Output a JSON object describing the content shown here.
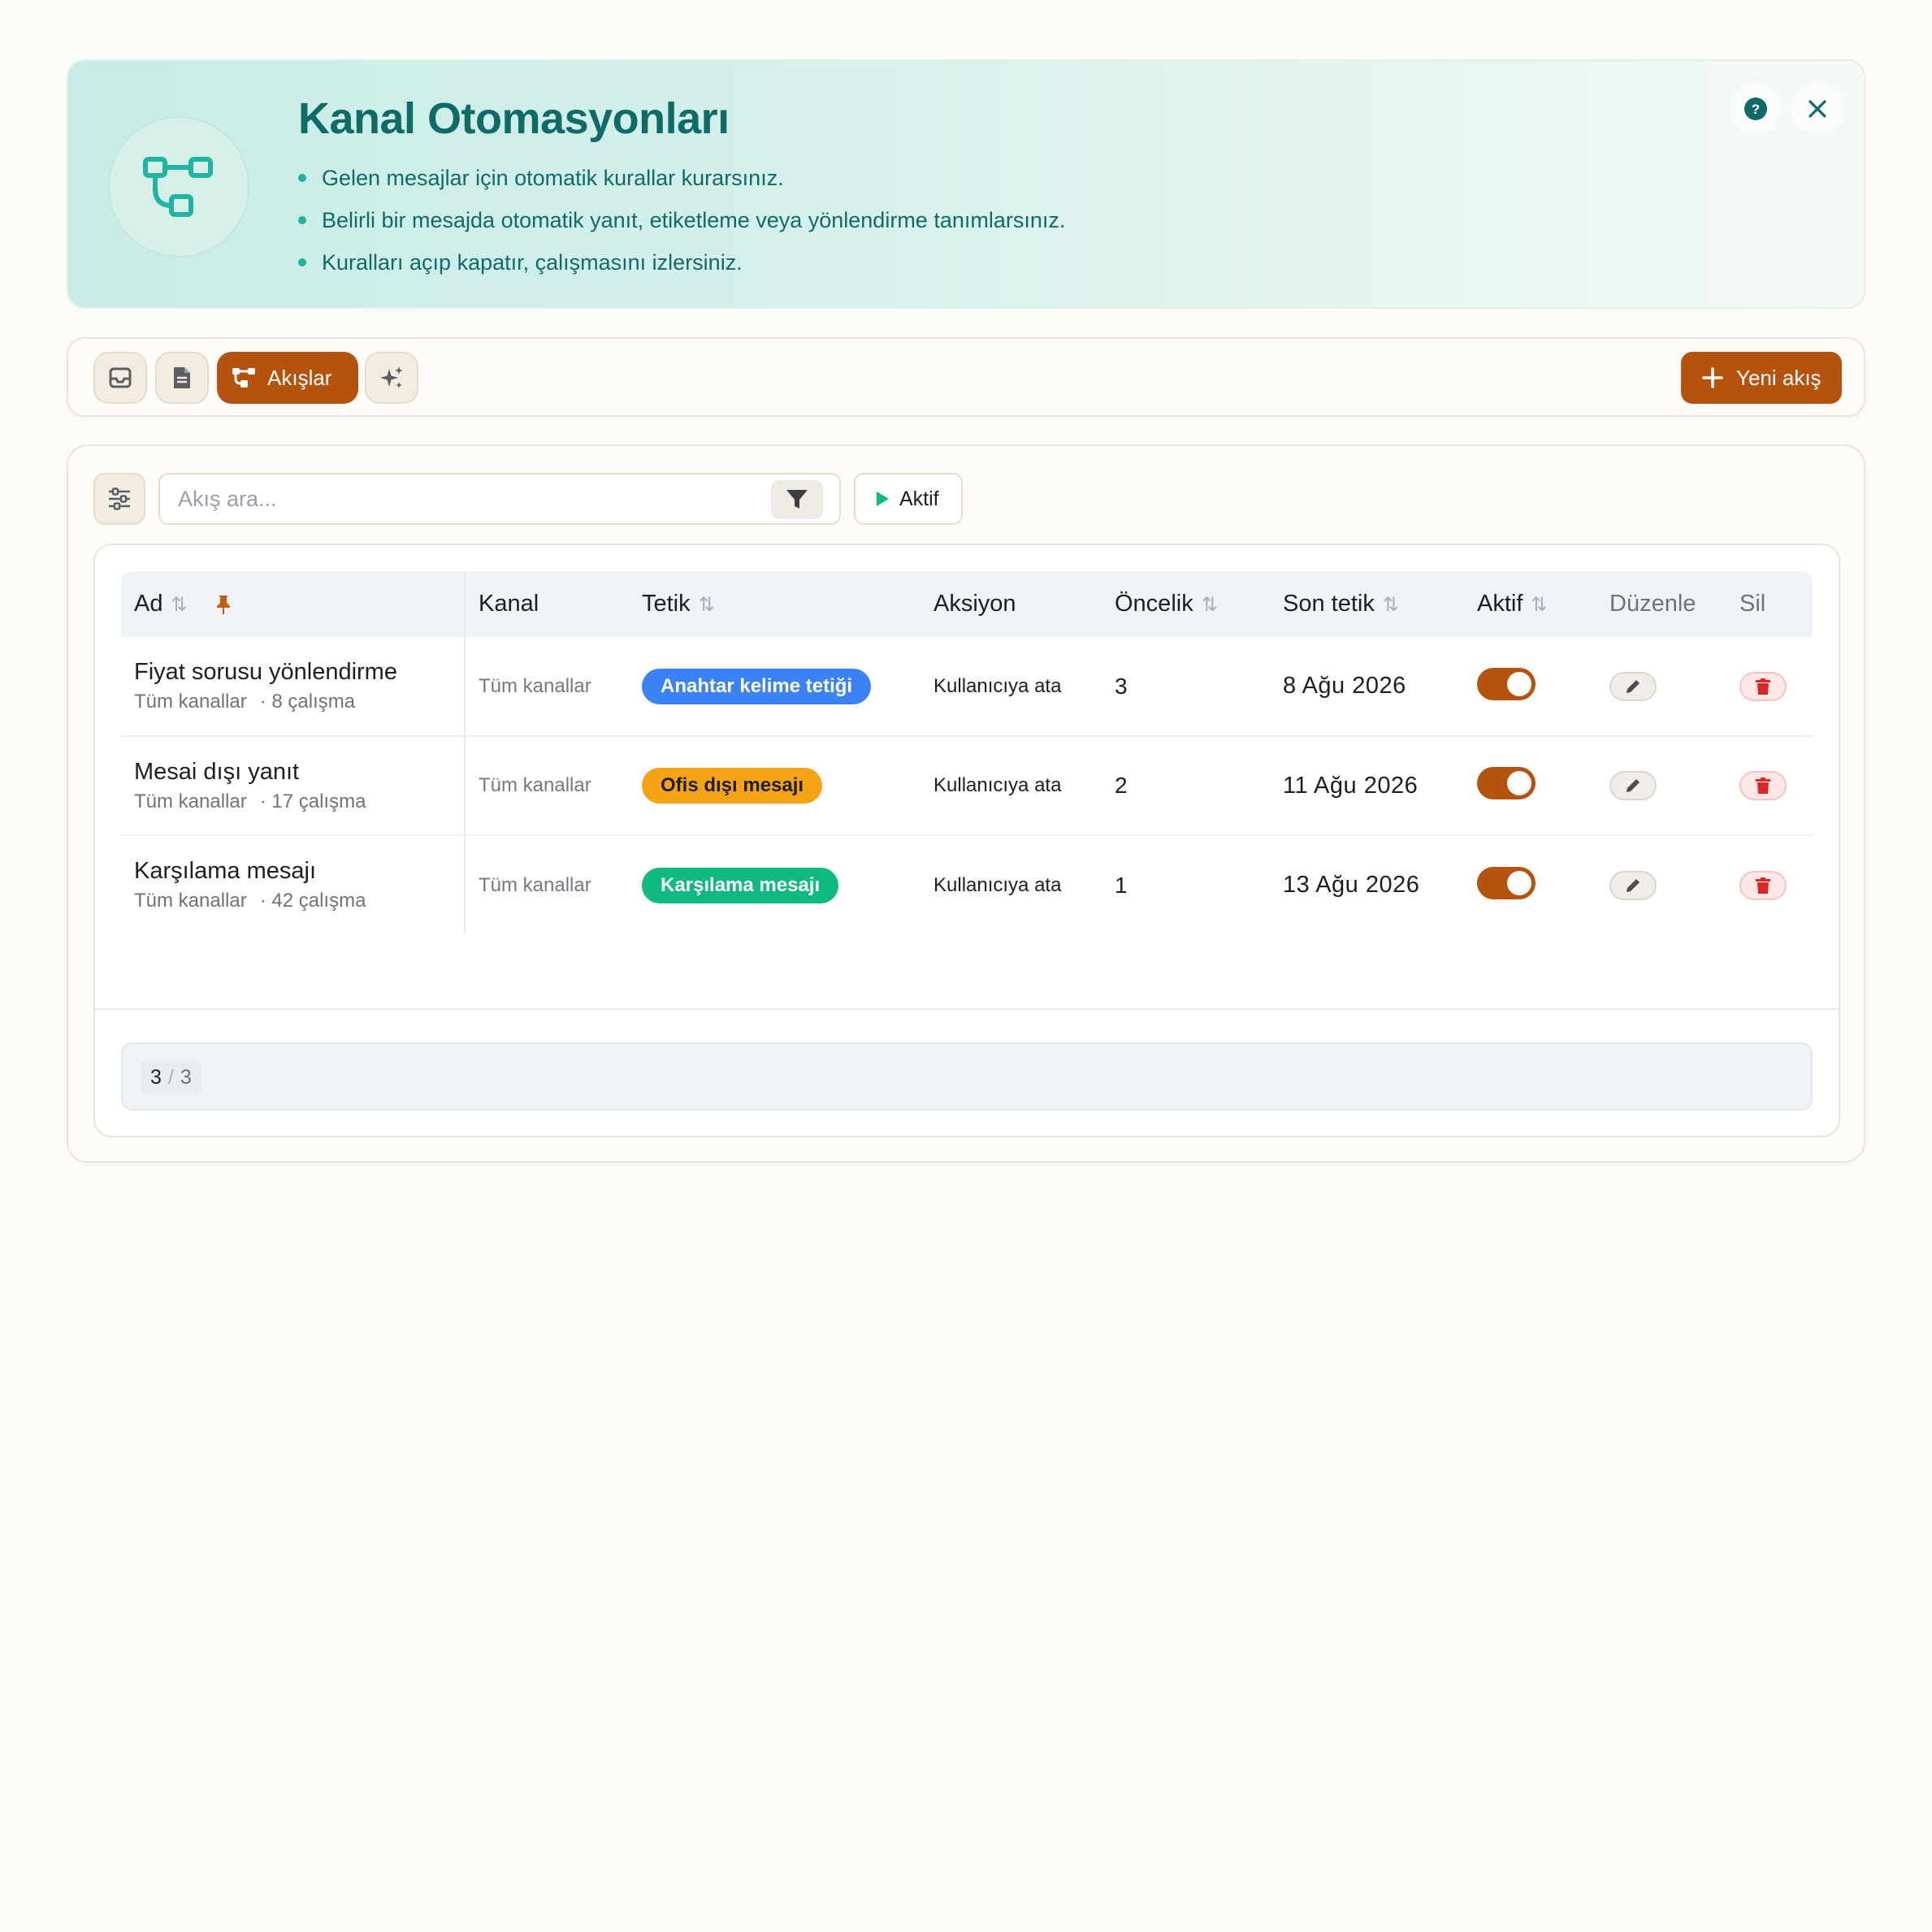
{
  "hero": {
    "title": "Kanal Otomasyonları",
    "bullets": [
      "Gelen mesajlar için otomatik kurallar kurarsınız.",
      "Belirli bir mesajda otomatik yanıt, etiketleme veya yönlendirme tanımlarsınız.",
      "Kuralları açıp kapatır, çalışmasını izlersiniz."
    ],
    "icon": "flow-diagram-icon",
    "actions": [
      "help-icon",
      "close-icon"
    ]
  },
  "toolbar": {
    "tabs": [
      {
        "icon": "inbox-icon"
      },
      {
        "icon": "document-icon"
      },
      {
        "icon": "flow-icon",
        "label": "Akışlar",
        "active": true
      },
      {
        "icon": "sparkle-icon"
      }
    ],
    "new_button": "Yeni akış"
  },
  "filters": {
    "search_placeholder": "Akış ara...",
    "search_value": "",
    "status_chip": "Aktif"
  },
  "table": {
    "columns": {
      "name": "Ad",
      "channel": "Kanal",
      "trigger": "Tetik",
      "action": "Aksiyon",
      "priority": "Öncelik",
      "last_trigger": "Son tetik",
      "active": "Aktif",
      "edit": "Düzenle",
      "delete": "Sil"
    },
    "rows": [
      {
        "name": "Fiyat sorusu yönlendirme",
        "sub_channel": "Tüm kanallar",
        "runs": "· 8 çalışma",
        "channel": "Tüm kanallar",
        "trigger": "Anahtar kelime tetiği",
        "trigger_color": "#3b82f6",
        "action": "Kullanıcıya ata",
        "priority": "3",
        "last_trigger": "8 Ağu 2026",
        "active": true
      },
      {
        "name": "Mesai dışı yanıt",
        "sub_channel": "Tüm kanallar",
        "runs": "· 17 çalışma",
        "channel": "Tüm kanallar",
        "trigger": "Ofis dışı mesajı",
        "trigger_color": "#f5a314",
        "action": "Kullanıcıya ata",
        "priority": "2",
        "last_trigger": "11 Ağu 2026",
        "active": true
      },
      {
        "name": "Karşılama mesajı",
        "sub_channel": "Tüm kanallar",
        "runs": "· 42 çalışma",
        "channel": "Tüm kanallar",
        "trigger": "Karşılama mesajı",
        "trigger_color": "#10b981",
        "action": "Kullanıcıya ata",
        "priority": "1",
        "last_trigger": "13 Ağu 2026",
        "active": true
      }
    ]
  },
  "pagination": {
    "shown": "3",
    "separator": "/",
    "total": "3"
  },
  "colors": {
    "brand": "#b5520d",
    "hero_text": "#0f6b67",
    "hero_accent": "#22b3a0"
  }
}
